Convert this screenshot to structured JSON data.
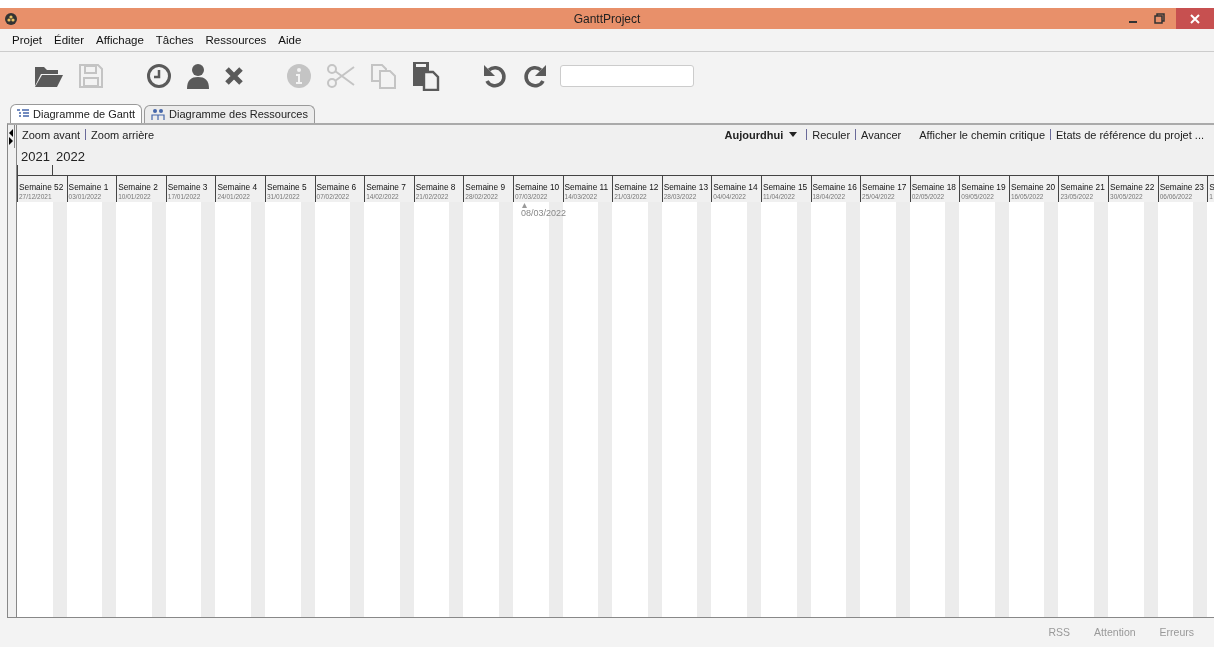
{
  "window": {
    "title": "GanttProject"
  },
  "menu": [
    {
      "label": "Projet"
    },
    {
      "label": "Éditer"
    },
    {
      "label": "Affichage"
    },
    {
      "label": "Tâches"
    },
    {
      "label": "Ressources"
    },
    {
      "label": "Aide"
    }
  ],
  "toolbar": [
    {
      "kind": "open",
      "disabled": false
    },
    {
      "kind": "save",
      "disabled": true
    },
    {
      "kind": "gap"
    },
    {
      "kind": "clock",
      "disabled": false
    },
    {
      "kind": "person",
      "disabled": false
    },
    {
      "kind": "delete",
      "disabled": false
    },
    {
      "kind": "gap"
    },
    {
      "kind": "info",
      "disabled": true
    },
    {
      "kind": "cut",
      "disabled": true
    },
    {
      "kind": "copy",
      "disabled": true
    },
    {
      "kind": "paste",
      "disabled": false
    },
    {
      "kind": "gap"
    },
    {
      "kind": "undo",
      "disabled": false
    },
    {
      "kind": "redo",
      "disabled": false
    },
    {
      "kind": "search"
    }
  ],
  "tabs": [
    {
      "label": "Diagramme de Gantt",
      "kind": "gantt",
      "selected": true
    },
    {
      "label": "Diagramme des Ressources",
      "kind": "resources",
      "selected": false
    }
  ],
  "chart_toolbar": {
    "left": [
      "Zoom avant",
      "Zoom arrière"
    ],
    "today": "Aujourdhui",
    "right": [
      "Reculer",
      "Avancer"
    ],
    "links": [
      "Afficher le chemin critique",
      "Etats de référence du projet ..."
    ]
  },
  "years": [
    {
      "label": "2021",
      "kind": "partial"
    },
    {
      "label": "2022",
      "kind": "full"
    }
  ],
  "weeks": [
    {
      "label": "Semaine 52",
      "date": "27/12/2021"
    },
    {
      "label": "Semaine 1",
      "date": "03/01/2022"
    },
    {
      "label": "Semaine 2",
      "date": "10/01/2022"
    },
    {
      "label": "Semaine 3",
      "date": "17/01/2022"
    },
    {
      "label": "Semaine 4",
      "date": "24/01/2022"
    },
    {
      "label": "Semaine 5",
      "date": "31/01/2022"
    },
    {
      "label": "Semaine 6",
      "date": "07/02/2022"
    },
    {
      "label": "Semaine 7",
      "date": "14/02/2022"
    },
    {
      "label": "Semaine 8",
      "date": "21/02/2022"
    },
    {
      "label": "Semaine 9",
      "date": "28/02/2022"
    },
    {
      "label": "Semaine 10",
      "date": "07/03/2022",
      "today": "08/03/2022"
    },
    {
      "label": "Semaine 11",
      "date": "14/03/2022"
    },
    {
      "label": "Semaine 12",
      "date": "21/03/2022"
    },
    {
      "label": "Semaine 13",
      "date": "28/03/2022"
    },
    {
      "label": "Semaine 14",
      "date": "04/04/2022"
    },
    {
      "label": "Semaine 15",
      "date": "11/04/2022"
    },
    {
      "label": "Semaine 16",
      "date": "18/04/2022"
    },
    {
      "label": "Semaine 17",
      "date": "25/04/2022"
    },
    {
      "label": "Semaine 18",
      "date": "02/05/2022"
    },
    {
      "label": "Semaine 19",
      "date": "09/05/2022"
    },
    {
      "label": "Semaine 20",
      "date": "16/05/2022"
    },
    {
      "label": "Semaine 21",
      "date": "23/05/2022"
    },
    {
      "label": "Semaine 22",
      "date": "30/05/2022"
    },
    {
      "label": "Semaine 23",
      "date": "06/06/2022"
    },
    {
      "label": "S",
      "date": "1"
    }
  ],
  "status_bar": [
    "RSS",
    "Attention",
    "Erreurs"
  ]
}
